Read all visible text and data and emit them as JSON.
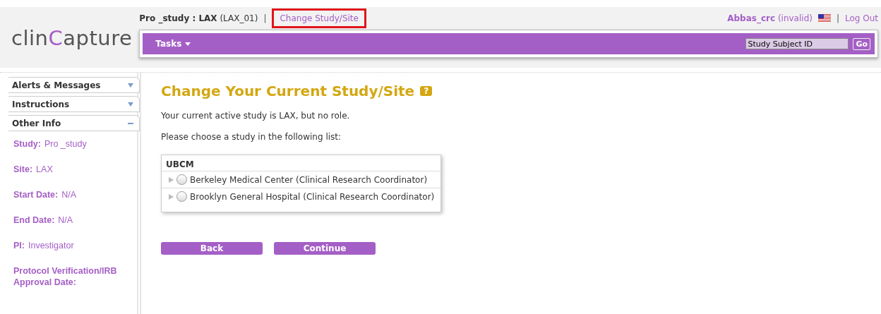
{
  "logo": {
    "before": "clin",
    "accent": "C",
    "after": "apture"
  },
  "breadcrumb": "**Pro _study : LAX** (LAX_01)",
  "breadcrumb_separator": "|",
  "change_link": {
    "label": "Change Study/Site",
    "highlighted": true
  },
  "user": "**Abbas_crc** (invalid)",
  "user_separator": "|",
  "logout": "Log Out",
  "nav": {
    "menu": "Tasks",
    "search": {
      "value": "Study Subject ID"
    },
    "go": "Go"
  },
  "sidebar": {
    "panels": [
      {
        "title": "Alerts & Messages",
        "expanded": false
      },
      {
        "title": "Instructions",
        "expanded": false
      },
      {
        "title": "Other Info",
        "expanded": true
      }
    ],
    "info": [
      {
        "label": "Study:",
        "value": "Pro _study"
      },
      {
        "label": "Site:",
        "value": "LAX"
      },
      {
        "label": "Start Date:",
        "value": "N/A"
      },
      {
        "label": "End Date:",
        "value": "N/A"
      },
      {
        "label": "PI:",
        "value": "Investigator"
      },
      {
        "label": "Protocol Verification/IRB Approval Date:"
      }
    ]
  },
  "main": {
    "title": "Change Your Current Study/Site",
    "help": "?",
    "status": "Your current active study is LAX, but no role.",
    "prompt": "Please choose a study in the following list:",
    "list": {
      "study": "UBCM",
      "sites": [
        {
          "label": "Berkeley Medical Center (Clinical Research Coordinator)",
          "selected": false
        },
        {
          "label": "Brooklyn General Hospital (Clinical Research Coordinator)",
          "selected": false
        }
      ]
    },
    "buttons": [
      "Back",
      "Continue"
    ]
  }
}
